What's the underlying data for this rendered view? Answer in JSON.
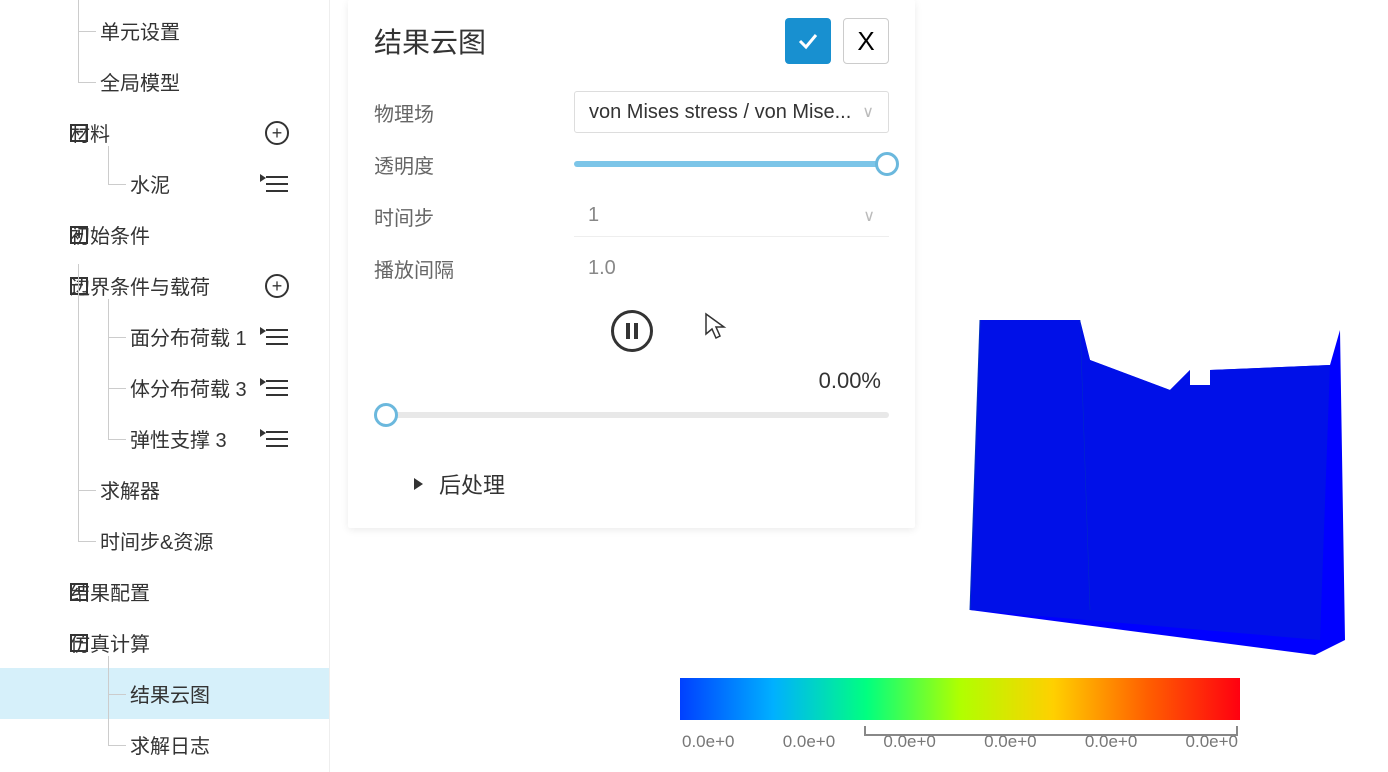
{
  "sidebar": {
    "items": [
      {
        "label": "单元设置",
        "depth": 2
      },
      {
        "label": "全局模型",
        "depth": 2
      },
      {
        "label": "材料",
        "depth": 1,
        "expand": "minus",
        "action": "plus"
      },
      {
        "label": "水泥",
        "depth": 3,
        "action": "list"
      },
      {
        "label": "初始条件",
        "depth": 1,
        "expand": "plus"
      },
      {
        "label": "边界条件与载荷",
        "depth": 1,
        "expand": "minus",
        "action": "plus"
      },
      {
        "label": "面分布荷载 1",
        "depth": 3,
        "action": "list"
      },
      {
        "label": "体分布荷载 3",
        "depth": 3,
        "action": "list"
      },
      {
        "label": "弹性支撑 3",
        "depth": 3,
        "action": "list"
      },
      {
        "label": "求解器",
        "depth": 2
      },
      {
        "label": "时间步&资源",
        "depth": 2
      },
      {
        "label": "结果配置",
        "depth": 1,
        "expand": "plus"
      },
      {
        "label": "仿真计算",
        "depth": 1,
        "expand": "minus"
      },
      {
        "label": "结果云图",
        "depth": 3,
        "selected": true
      },
      {
        "label": "求解日志",
        "depth": 3
      }
    ]
  },
  "panel": {
    "title": "结果云图",
    "field_label": "物理场",
    "field_value": "von Mises stress / von Mise...",
    "opacity_label": "透明度",
    "timestep_label": "时间步",
    "timestep_value": "1",
    "interval_label": "播放间隔",
    "interval_value": "1.0",
    "percent": "0.00%",
    "postprocess_label": "后处理",
    "close_label": "X"
  },
  "colorbar": {
    "labels": [
      "0.0e+0",
      "0.0e+0",
      "0.0e+0",
      "0.0e+0",
      "0.0e+0",
      "0.0e+0"
    ]
  }
}
